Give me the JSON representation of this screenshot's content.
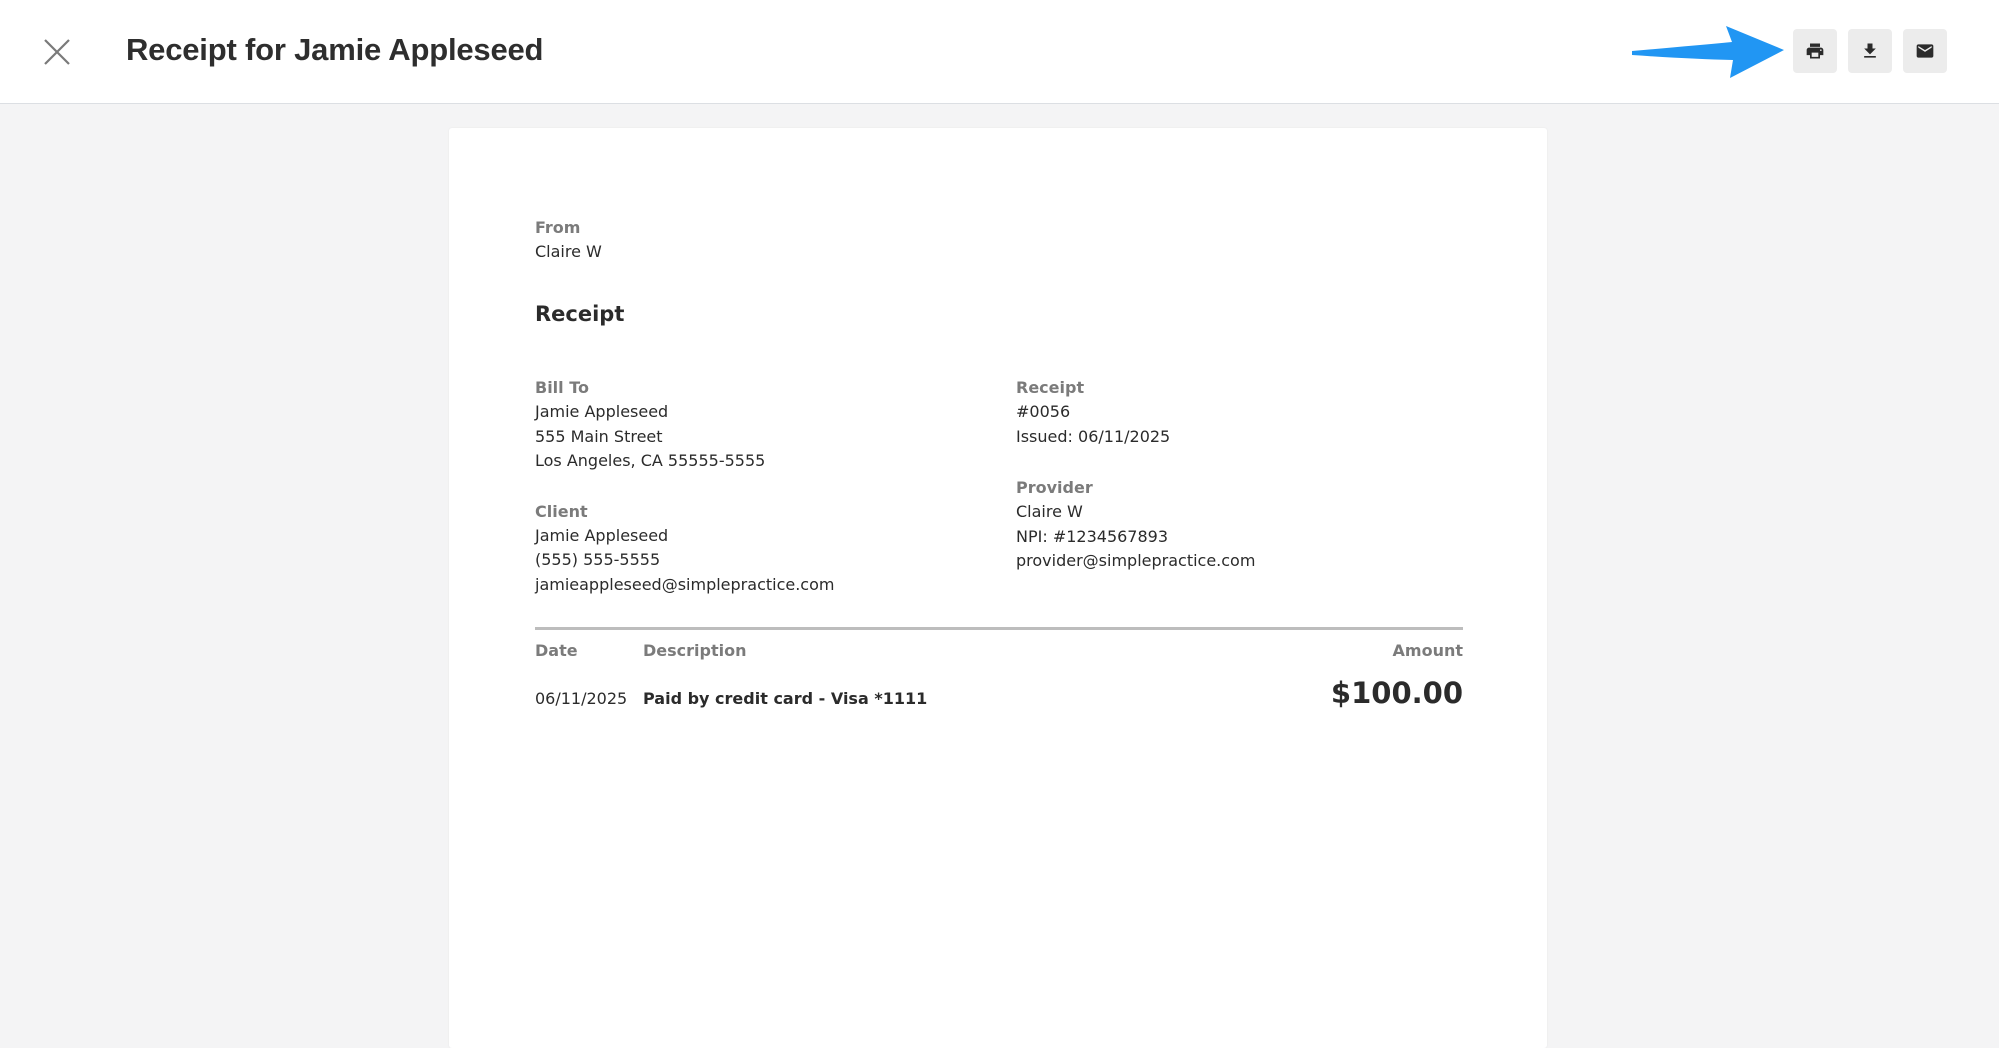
{
  "header": {
    "title": "Receipt for Jamie Appleseed",
    "actions": [
      {
        "name": "print",
        "icon": "printer-icon"
      },
      {
        "name": "download",
        "icon": "download-icon"
      },
      {
        "name": "email",
        "icon": "email-icon"
      }
    ],
    "arrow_color": "#2196f3"
  },
  "receipt": {
    "from_label": "From",
    "from_name": "Claire W",
    "heading": "Receipt",
    "bill_to": {
      "label": "Bill To",
      "name": "Jamie Appleseed",
      "street": "555 Main Street",
      "city": "Los Angeles, CA 55555-5555"
    },
    "client": {
      "label": "Client",
      "name": "Jamie Appleseed",
      "phone": "(555) 555-5555",
      "email": "jamieappleseed@simplepractice.com"
    },
    "receipt_info": {
      "label": "Receipt",
      "number": "#0056",
      "issued": "Issued: 06/11/2025"
    },
    "provider": {
      "label": "Provider",
      "name": "Claire W",
      "npi": "NPI: #1234567893",
      "email": "provider@simplepractice.com"
    },
    "table": {
      "headers": {
        "date": "Date",
        "description": "Description",
        "amount": "Amount"
      },
      "rows": [
        {
          "date": "06/11/2025",
          "description": "Paid by credit card - Visa *1111",
          "amount": "$100.00"
        }
      ]
    }
  }
}
